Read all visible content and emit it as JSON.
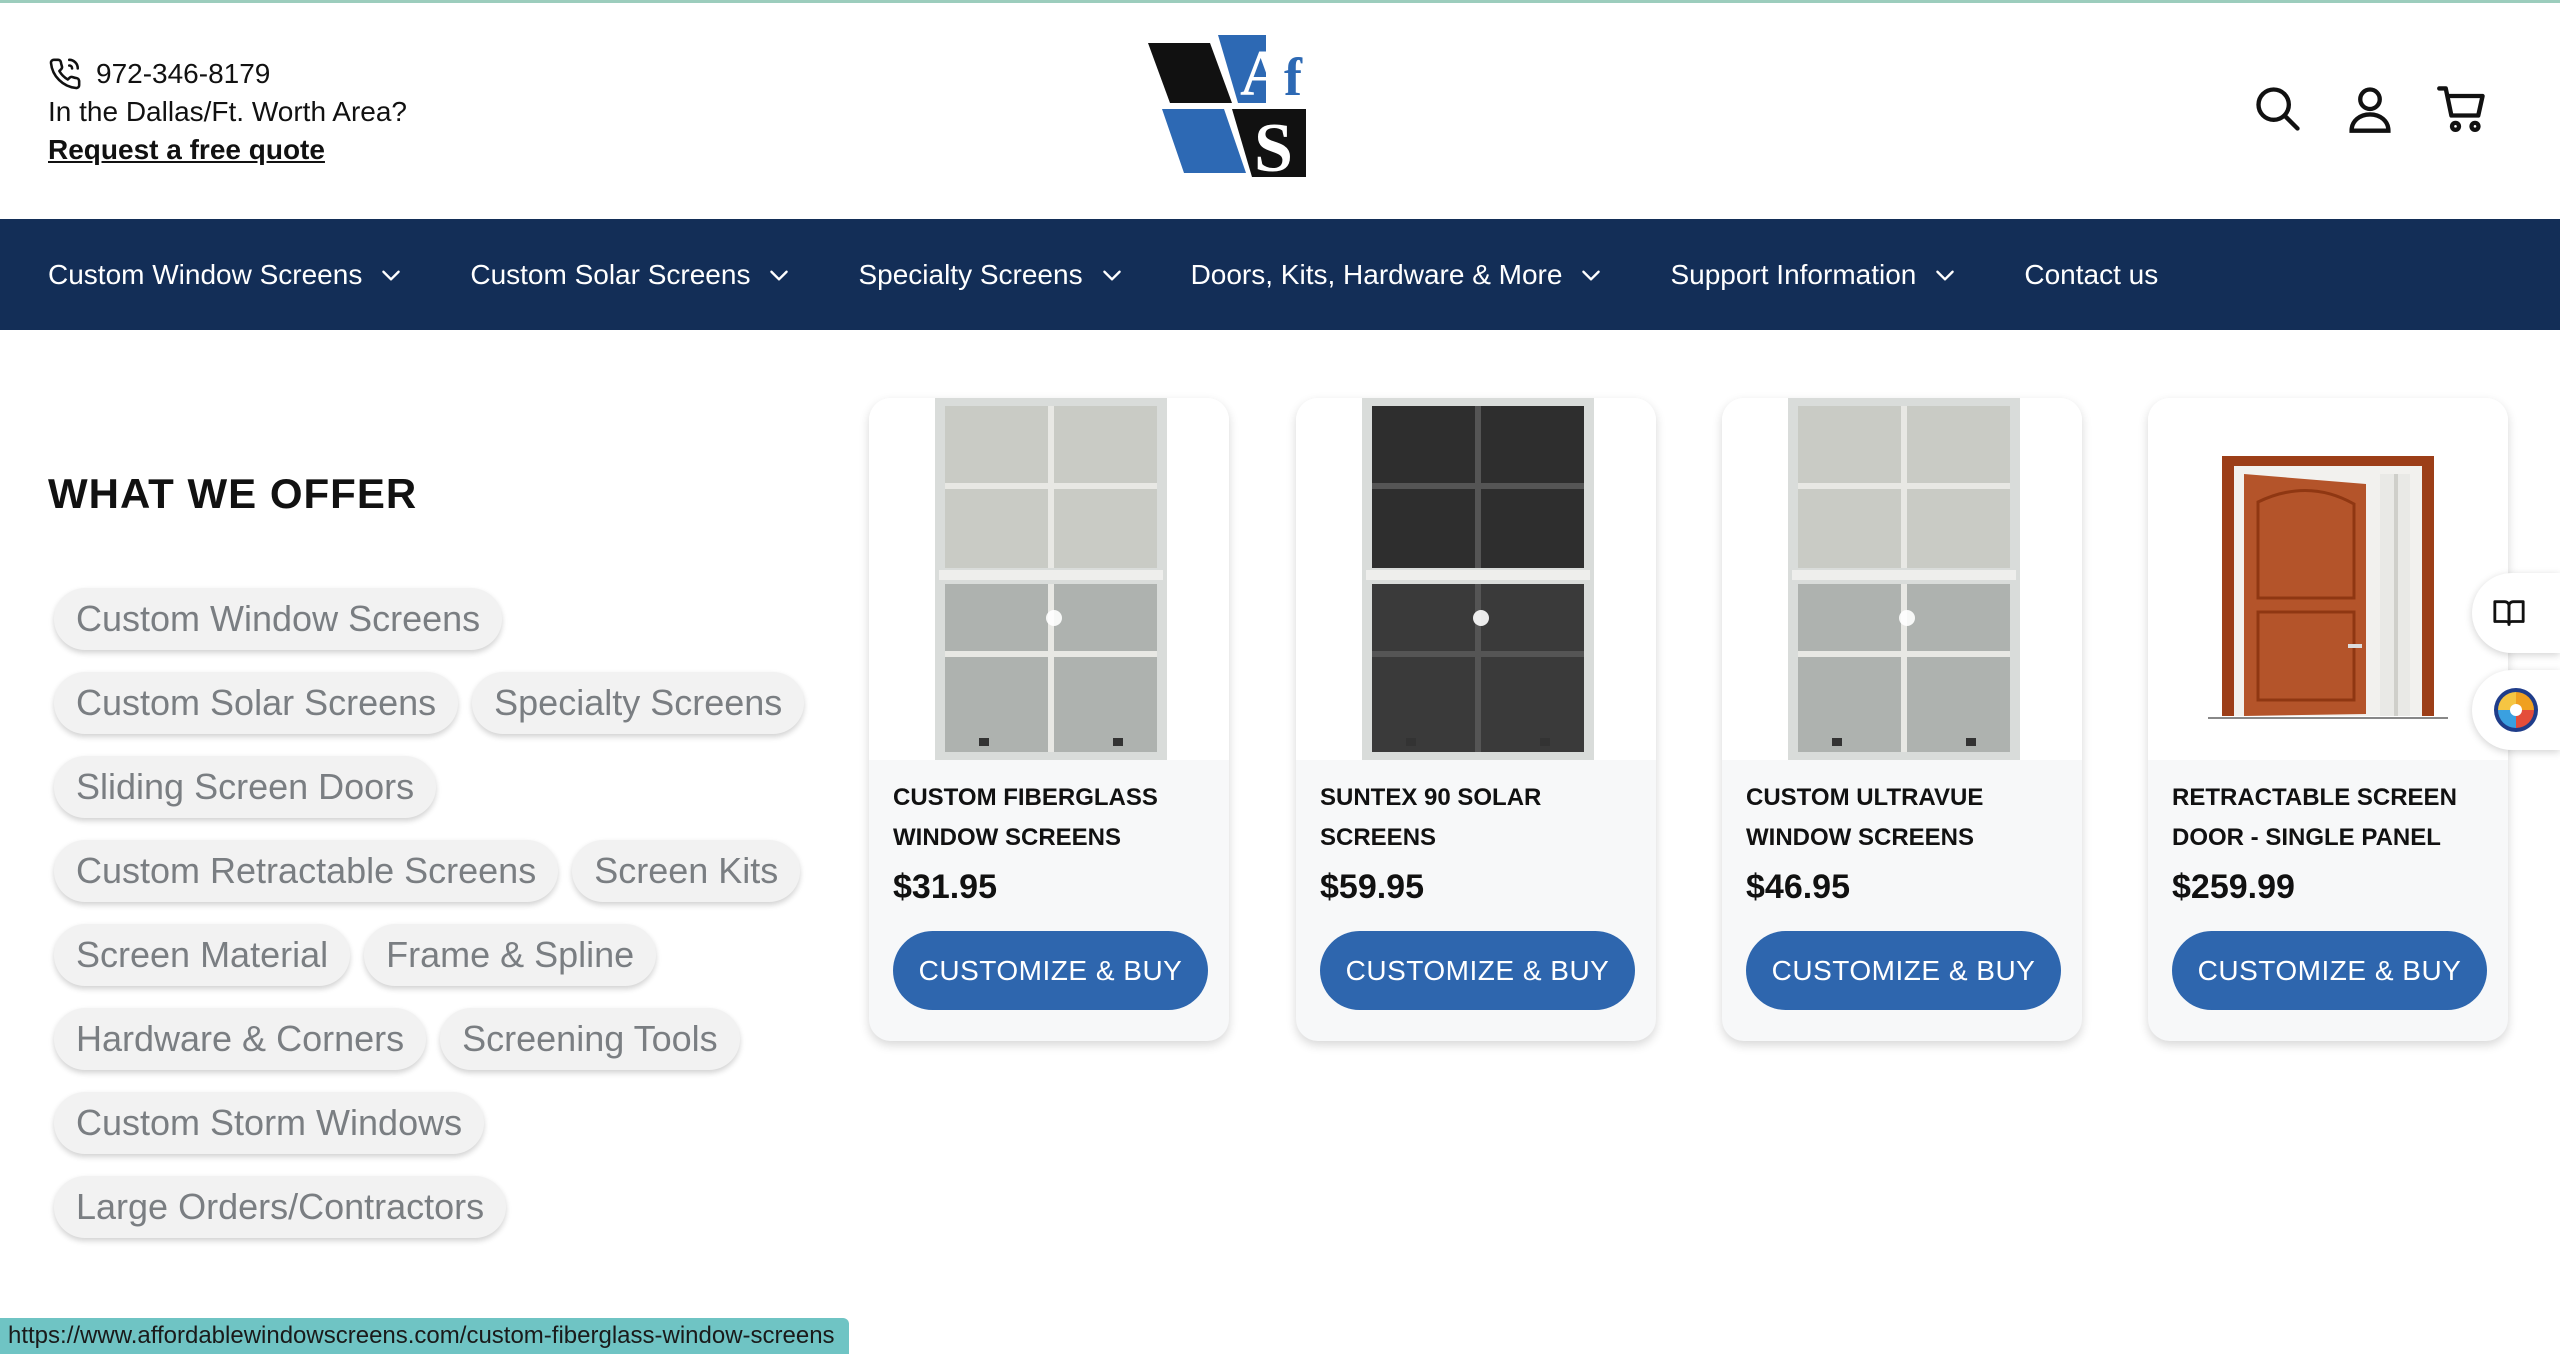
{
  "header": {
    "phone": "972-346-8179",
    "area_text": "In the Dallas/Ft. Worth Area?",
    "quote_link": "Request a free quote",
    "logo_letters": "AfS"
  },
  "icons": {
    "phone": "phone-icon",
    "search": "search-icon",
    "account": "account-icon",
    "cart": "cart-icon",
    "chevron": "chevron-down-icon",
    "book": "book-icon",
    "accessibility": "accessibility-icon"
  },
  "nav": {
    "items": [
      {
        "label": "Custom Window Screens",
        "has_menu": true
      },
      {
        "label": "Custom Solar Screens",
        "has_menu": true
      },
      {
        "label": "Specialty Screens",
        "has_menu": true
      },
      {
        "label": "Doors, Kits, Hardware & More",
        "has_menu": true
      },
      {
        "label": "Support Information",
        "has_menu": true
      },
      {
        "label": "Contact us",
        "has_menu": false
      }
    ]
  },
  "offer": {
    "title": "WHAT WE OFFER",
    "pills": [
      "Custom Window Screens",
      "Custom Solar Screens",
      "Specialty Screens",
      "Sliding Screen Doors",
      "Custom Retractable Screens",
      "Screen Kits",
      "Screen Material",
      "Frame & Spline",
      "Hardware & Corners",
      "Screening Tools",
      "Custom Storm Windows",
      "Large Orders/Contractors"
    ]
  },
  "products": [
    {
      "title": "CUSTOM FIBERGLASS WINDOW SCREENS",
      "price": "$31.95",
      "button": "CUSTOMIZE & BUY"
    },
    {
      "title": "SUNTEX 90 SOLAR SCREENS",
      "price": "$59.95",
      "button": "CUSTOMIZE & BUY"
    },
    {
      "title": "CUSTOM ULTRAVUE WINDOW SCREENS",
      "price": "$46.95",
      "button": "CUSTOMIZE & BUY"
    },
    {
      "title": "RETRACTABLE SCREEN DOOR - SINGLE PANEL",
      "price": "$259.99",
      "button": "CUSTOMIZE & BUY"
    }
  ],
  "status_url": "https://www.affordablewindowscreens.com/custom-fiberglass-window-screens",
  "colors": {
    "nav_bg": "#132e57",
    "button_bg": "#2e66ae",
    "logo_blue": "#2d69b4",
    "status_bg": "#6fc4c4"
  }
}
